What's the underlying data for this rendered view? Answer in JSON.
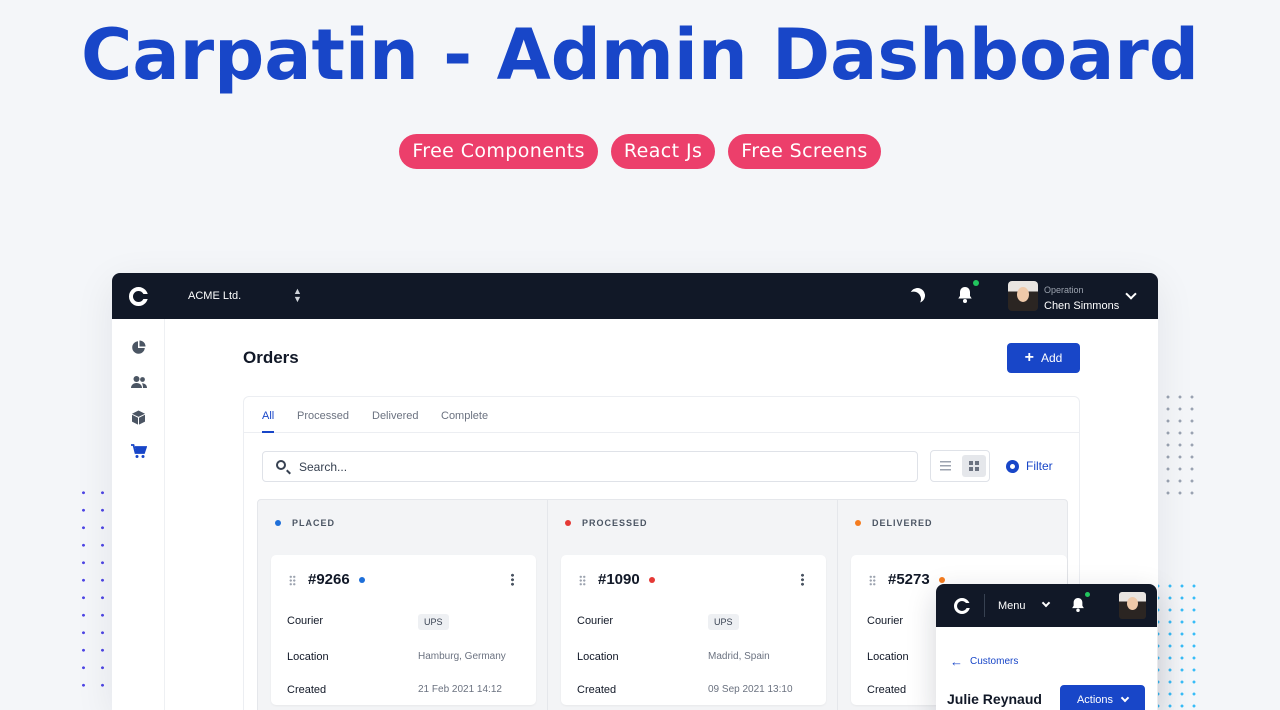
{
  "hero": {
    "title": "Carpatin - Admin Dashboard",
    "pills": [
      "Free Components",
      "React Js",
      "Free Screens"
    ]
  },
  "colors": {
    "brand_blue": "#1846c8",
    "pill_pink": "#ec3f6b",
    "topbar_dark": "#111827",
    "status_placed": "#1e6fd9",
    "status_processed": "#e53935",
    "status_delivered": "#f57c1f",
    "online_dot": "#22c55e"
  },
  "topbar": {
    "logo_icon": "carpatin-logo-icon",
    "organization": "ACME Ltd.",
    "org_switch_icon": "chevron-up-down-icon",
    "theme_icon": "moon-icon",
    "notifications_icon": "bell-icon",
    "user": {
      "role": "Operation",
      "name": "Chen Simmons"
    },
    "user_menu_icon": "chevron-down-icon"
  },
  "sidebar": {
    "items": [
      {
        "icon": "pie-chart-icon"
      },
      {
        "icon": "users-icon"
      },
      {
        "icon": "cube-icon"
      },
      {
        "icon": "cart-icon",
        "active": true
      }
    ]
  },
  "main": {
    "title": "Orders",
    "add_label": "Add",
    "tabs": [
      {
        "label": "All",
        "active": true
      },
      {
        "label": "Processed"
      },
      {
        "label": "Delivered"
      },
      {
        "label": "Complete"
      }
    ],
    "search": {
      "placeholder": "Search...",
      "value": ""
    },
    "view_icons": [
      "list-view-icon",
      "grid-view-icon"
    ],
    "filter_label": "Filter",
    "columns": [
      {
        "status": "PLACED",
        "order": {
          "id": "#9266",
          "courier": "UPS",
          "location": "Hamburg, Germany",
          "created": "21 Feb 2021 14:12"
        }
      },
      {
        "status": "PROCESSED",
        "order": {
          "id": "#1090",
          "courier": "UPS",
          "location": "Madrid, Spain",
          "created": "09 Sep 2021 13:10"
        }
      },
      {
        "status": "DELIVERED",
        "order": {
          "id": "#5273",
          "courier": "",
          "location": "",
          "created": ""
        }
      }
    ],
    "field_labels": {
      "courier": "Courier",
      "location": "Location",
      "created": "Created"
    }
  },
  "mobile": {
    "menu_label": "Menu",
    "back_label": "Customers",
    "customer_name": "Julie Reynaud",
    "actions_label": "Actions"
  }
}
